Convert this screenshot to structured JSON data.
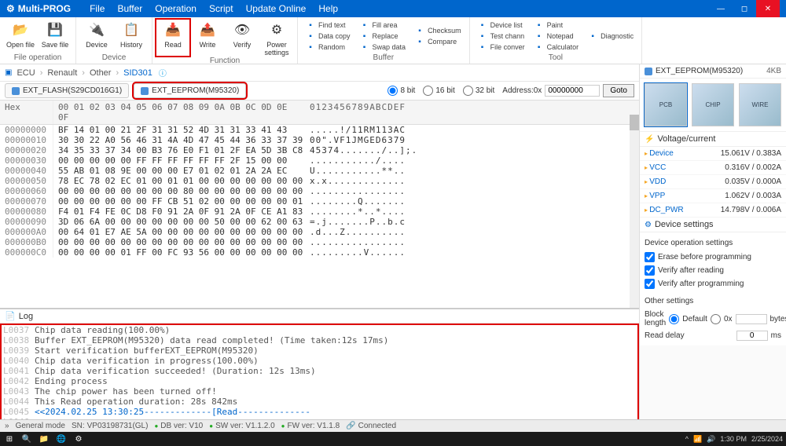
{
  "app": {
    "title": "Multi-PROG"
  },
  "menu": [
    "File",
    "Buffer",
    "Operation",
    "Script",
    "Update Online",
    "Help"
  ],
  "ribbon": {
    "groups": [
      {
        "label": "File operation",
        "buttons": [
          {
            "name": "open-file",
            "label": "Open file",
            "icon": "📂"
          },
          {
            "name": "save-file",
            "label": "Save file",
            "icon": "💾"
          }
        ]
      },
      {
        "label": "Device",
        "buttons": [
          {
            "name": "device",
            "label": "Device",
            "icon": "🔌"
          },
          {
            "name": "history",
            "label": "History",
            "icon": "📋"
          }
        ]
      },
      {
        "label": "Function",
        "buttons": [
          {
            "name": "read",
            "label": "Read",
            "icon": "📥",
            "highlighted": true
          },
          {
            "name": "write",
            "label": "Write",
            "icon": "📤"
          },
          {
            "name": "verify",
            "label": "Verify",
            "icon": "👁"
          },
          {
            "name": "power-settings",
            "label": "Power settings",
            "icon": "⚙"
          }
        ]
      },
      {
        "label": "Buffer",
        "sub": [
          [
            "Find text",
            "Data copy",
            "Random"
          ],
          [
            "Fill area",
            "Replace",
            "Swap data"
          ],
          [
            "Checksum",
            "Compare",
            ""
          ]
        ]
      },
      {
        "label": "Tool",
        "sub": [
          [
            "Device list",
            "Test chann",
            "File conver"
          ],
          [
            "Paint",
            "Notepad",
            "Calculator"
          ],
          [
            "Diagnostic",
            "",
            ""
          ]
        ]
      }
    ]
  },
  "breadcrumb": [
    "ECU",
    "Renault",
    "Other",
    "SID301"
  ],
  "tabs": [
    {
      "name": "ext-flash",
      "label": "EXT_FLASH(S29CD016G1)"
    },
    {
      "name": "ext-eeprom",
      "label": "EXT_EEPROM(M95320)",
      "highlighted": true,
      "active": true
    }
  ],
  "bitsel": {
    "b8": "8 bit",
    "b16": "16 bit",
    "b32": "32 bit",
    "selected": "8"
  },
  "address": {
    "label": "Address:0x",
    "value": "00000000",
    "goto": "Goto"
  },
  "hex": {
    "header_label": "Hex",
    "cols": "00 01 02 03 04 05 06 07 08 09 0A 0B 0C 0D 0E 0F",
    "ascii_hdr": "0123456789ABCDEF",
    "rows": [
      {
        "o": "00000000",
        "b": "BF 14 01 00 21 2F 31 31 52 4D 31 31 33 41 43",
        "a": ".....!/11RM113AC"
      },
      {
        "o": "00000010",
        "b": "30 30 22 A0 56 46 31 4A 4D 47 45 44 36 33 37 39",
        "a": "00\".VF1JMGED6379"
      },
      {
        "o": "00000020",
        "b": "34 35 33 37 34 00 B3 76 E0 F1 01 2F EA 5D 3B C8",
        "a": "45374......./..];."
      },
      {
        "o": "00000030",
        "b": "00 00 00 00 00 FF FF FF FF FF FF 2F 15 00 00",
        "a": ".........../...."
      },
      {
        "o": "00000040",
        "b": "55 AB 01 08 9E 00 00 00 E7 01 02 01 2A 2A EC",
        "a": "U...........**.."
      },
      {
        "o": "00000050",
        "b": "78 EC 78 02 EC 01 00 01 01 00 00 00 00 00 00 00",
        "a": "x.x............."
      },
      {
        "o": "00000060",
        "b": "00 00 00 00 00 00 00 00 80 00 00 00 00 00 00 00",
        "a": "................"
      },
      {
        "o": "00000070",
        "b": "00 00 00 00 00 00 FF CB 51 02 00 00 00 00 00 01",
        "a": "........Q......."
      },
      {
        "o": "00000080",
        "b": "F4 01 F4 FE 0C D8 F0 91 2A 0F 91 2A 0F CE A1 83",
        "a": "........*..*...."
      },
      {
        "o": "00000090",
        "b": "3D 06 6A 00 00 00 00 00 00 00 50 00 00 62 00 63",
        "a": "=.j.......P..b.c"
      },
      {
        "o": "000000A0",
        "b": "00 64 01 E7 AE 5A 00 00 00 00 00 00 00 00 00 00",
        "a": ".d...Z.........."
      },
      {
        "o": "000000B0",
        "b": "00 00 00 00 00 00 00 00 00 00 00 00 00 00 00 00",
        "a": "................"
      },
      {
        "o": "000000C0",
        "b": "00 00 00 00 01 FF 00 FC 93 56 00 00 00 00 00 00",
        "a": ".........V......"
      }
    ]
  },
  "log": {
    "title": "Log",
    "lines": [
      {
        "n": "L0037",
        "t": "Chip data reading(100.00%)"
      },
      {
        "n": "L0038",
        "t": "Buffer EXT_EEPROM(M95320) data read completed! (Time taken:12s 17ms)"
      },
      {
        "n": "L0039",
        "t": "Start verification bufferEXT_EEPROM(M95320)"
      },
      {
        "n": "L0040",
        "t": "Chip data verification in progress(100.00%)"
      },
      {
        "n": "L0041",
        "t": "Chip data verification succeeded! (Duration: 12s 13ms)"
      },
      {
        "n": "L0042",
        "t": "Ending process"
      },
      {
        "n": "L0043",
        "t": "The chip power has been turned off!"
      },
      {
        "n": "L0044",
        "t": "This Read operation duration: 28s 842ms"
      },
      {
        "n": "L0045",
        "t": "<<2024.02.25 13:30:25-------------[Read--------------",
        "blue": true
      },
      {
        "n": "L0046",
        "t": ""
      }
    ]
  },
  "right": {
    "device_name": "EXT_EEPROM(M95320)",
    "size": "4KB",
    "vc_title": "Voltage/current",
    "vc": [
      {
        "k": "Device",
        "v": "15.061V / 0.383A"
      },
      {
        "k": "VCC",
        "v": "0.316V / 0.002A"
      },
      {
        "k": "VDD",
        "v": "0.035V / 0.000A"
      },
      {
        "k": "VPP",
        "v": "1.062V / 0.003A"
      },
      {
        "k": "DC_PWR",
        "v": "14.798V / 0.006A"
      }
    ],
    "settings_title": "Device settings",
    "op_title": "Device operation settings",
    "op": [
      "Erase before programming",
      "Verify after reading",
      "Verify after programming"
    ],
    "other_title": "Other settings",
    "block_label": "Block length",
    "block_default": "Default",
    "block_0x": "0x",
    "block_unit": "bytes",
    "read_delay_label": "Read delay",
    "read_delay_value": "0",
    "read_delay_unit": "ms"
  },
  "status": {
    "mode": "General mode",
    "sn_label": "SN:",
    "sn": "VP03198731(GL)",
    "db": "DB ver: V10",
    "sw": "SW ver: V1.1.2.0",
    "fw": "FW ver: V1.1.8",
    "conn": "Connected"
  },
  "taskbar": {
    "time": "1:30 PM",
    "date": "2/25/2024"
  }
}
